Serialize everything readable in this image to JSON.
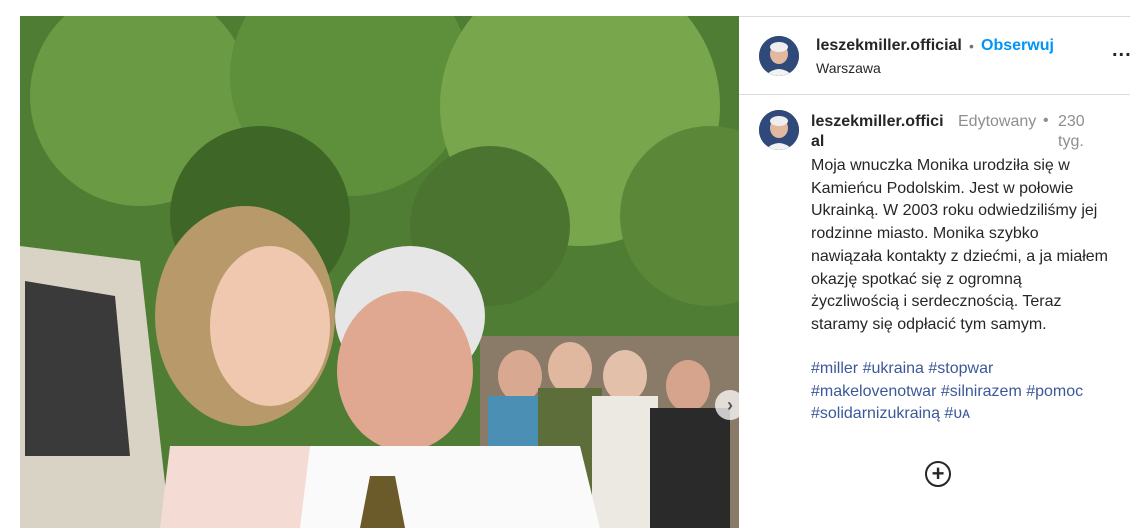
{
  "post": {
    "author": "leszekmiller.official",
    "separator": "•",
    "follow_label": "Obserwuj",
    "location": "Warszawa",
    "more_icon": "more-options-icon",
    "more_label": "..."
  },
  "comment": {
    "author": "leszekmiller.official",
    "edited_label": "Edytowany",
    "separator": "•",
    "time": "230 tyg.",
    "text": "Moja wnuczka Monika urodziła się w Kamieńcu Podolskim. Jest w połowie Ukrainką. W 2003 roku odwiedziliśmy jej rodzinne miasto. Monika szybko nawiązała kontakty z dziećmi, a ja miałem okazję spotkać się z ogromną życzliwością i serdecznością. Teraz staramy się odpłacić tym samym.",
    "hashtags": [
      "#miller",
      "#ukraina",
      "#stopwar",
      "#makelovenotwar",
      "#silnirazem",
      "#pomoc",
      "#solidarnizukrainą",
      "#ᴜᴀ"
    ]
  },
  "controls": {
    "next_icon": "chevron-right-icon",
    "next_glyph": "›",
    "load_more_icon": "plus-circle-icon",
    "load_more_glyph": "+"
  },
  "colors": {
    "link": "#0095f6",
    "hashtag": "#3b5998",
    "muted": "#8e8e8e",
    "border": "#dbdbdb"
  }
}
